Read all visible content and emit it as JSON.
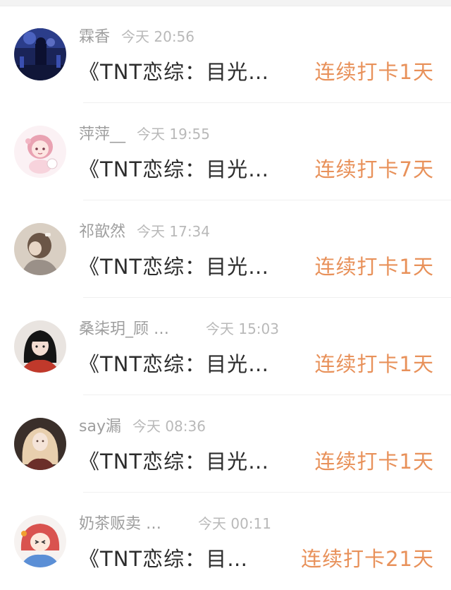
{
  "feed": {
    "items": [
      {
        "username": "霖香",
        "time": "今天 20:56",
        "topic": "《TNT恋综：目光…",
        "streak": "连续打卡1天",
        "avatar_icon": "avatar-dark-concert-icon"
      },
      {
        "username": "萍萍__",
        "time": "今天 19:55",
        "topic": "《TNT恋综：目光…",
        "streak": "连续打卡7天",
        "avatar_icon": "avatar-anime-pink-girl-icon"
      },
      {
        "username": "祁歆然",
        "time": "今天 17:34",
        "topic": "《TNT恋综：目光…",
        "streak": "连续打卡1天",
        "avatar_icon": "avatar-girl-back-hairclip-icon"
      },
      {
        "username": "桑柒玥_顾 …",
        "time": "今天 15:03",
        "topic": "《TNT恋综：目光…",
        "streak": "连续打卡1天",
        "avatar_icon": "avatar-girl-black-hair-icon"
      },
      {
        "username": "say漏",
        "time": "今天 08:36",
        "topic": "《TNT恋综：目光…",
        "streak": "连续打卡1天",
        "avatar_icon": "avatar-girl-blonde-curly-icon"
      },
      {
        "username": "奶茶贩卖 …",
        "time": "今天 00:11",
        "topic": "《TNT恋综：目…",
        "streak": "连续打卡21天",
        "avatar_icon": "avatar-anime-redhair-icon"
      }
    ]
  },
  "colors": {
    "streak": "#e8915a",
    "username": "#9e9e9e",
    "time": "#b9b9b9",
    "topic": "#2c2c2c"
  }
}
